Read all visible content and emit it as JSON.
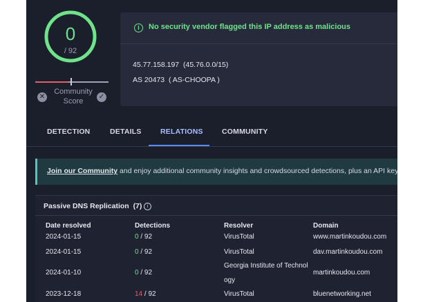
{
  "score": {
    "value": "0",
    "total": "/ 92",
    "community_label_line1": "Community",
    "community_label_line2": "Score",
    "down_vote_icon": "x-circle-icon",
    "up_vote_icon": "check-circle-icon",
    "ring_color": "#6ee38a"
  },
  "info": {
    "banner_icon": "info-circle-icon",
    "banner_text": "No security vendor flagged this IP address as malicious",
    "ip": "45.77.158.197",
    "ip_range": "(45.76.0.0/15)",
    "as_number": "AS 20473",
    "as_name": "( AS-CHOOPA )"
  },
  "tabs": [
    {
      "label": "DETECTION",
      "active": false
    },
    {
      "label": "DETAILS",
      "active": false
    },
    {
      "label": "RELATIONS",
      "active": true
    },
    {
      "label": "COMMUNITY",
      "active": false
    }
  ],
  "community_banner": {
    "link_text": "Join our Community",
    "rest_text": " and enjoy additional community insights and crowdsourced detections, plus an API key"
  },
  "passive_dns": {
    "title": "Passive DNS Replication",
    "count": "(7)",
    "info_icon": "info-circle-icon",
    "headers": [
      "Date resolved",
      "Detections",
      "Resolver",
      "Domain"
    ],
    "rows": [
      {
        "date": "2024-01-15",
        "det_count": "0",
        "det_total": " / 92",
        "resolver_line1": "VirusTotal",
        "resolver_line2": "",
        "domain": "www.martinkoudou.com"
      },
      {
        "date": "2024-01-15",
        "det_count": "0",
        "det_total": " / 92",
        "resolver_line1": "VirusTotal",
        "resolver_line2": "",
        "domain": "dav.martinkoudou.com"
      },
      {
        "date": "2024-01-10",
        "det_count": "0",
        "det_total": " / 92",
        "resolver_line1": "Georgia Institute of Technol",
        "resolver_line2": "ogy",
        "domain": "martinkoudou.com"
      },
      {
        "date": "2023-12-18",
        "det_count": "14",
        "det_total": " / 92",
        "resolver_line1": "VirusTotal",
        "resolver_line2": "",
        "domain": "bluenetworking.net"
      }
    ]
  },
  "colors": {
    "panel_bg": "#1b1e2b",
    "clean_green": "#6ee38a",
    "malicious_red": "#e2626a",
    "accent_blue": "#5b8cff"
  }
}
